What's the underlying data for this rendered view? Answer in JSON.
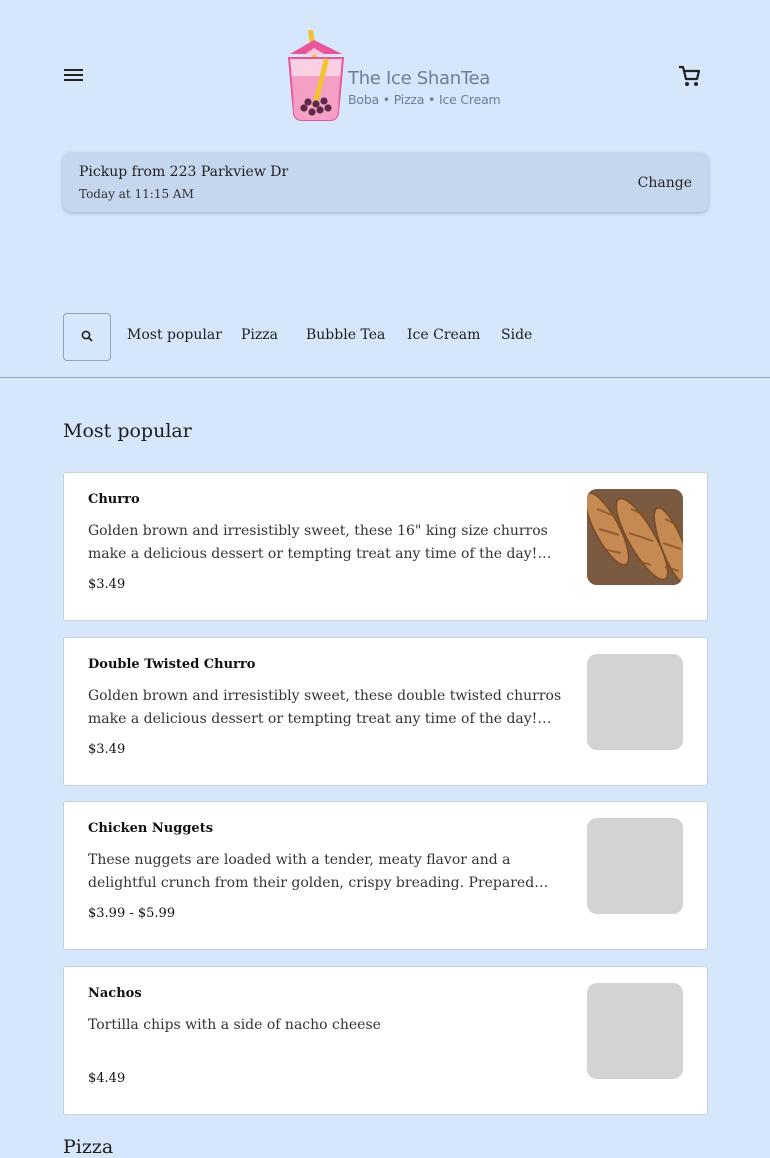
{
  "header": {
    "brand_name": "The Ice ShanTea",
    "brand_tagline": "Boba • Pizza • Ice Cream",
    "menu_icon": "hamburger-menu-icon",
    "cart_icon": "shopping-cart-icon"
  },
  "pickup": {
    "location": "Pickup from 223 Parkview Dr",
    "time": "Today at 11:15 AM",
    "change_label": "Change"
  },
  "categories": {
    "search_icon": "search-icon",
    "tabs": [
      "Most popular",
      "Pizza",
      "Bubble Tea",
      "Ice Cream",
      "Side"
    ]
  },
  "sections": [
    {
      "title": "Most popular",
      "items": [
        {
          "name": "Churro",
          "description": "Golden brown and irresistibly sweet, these 16\" king size churros make a delicious dessert or tempting treat any time of the day! Made using a traditional Hispanic recipe.",
          "price": "$3.49"
        },
        {
          "name": "Double Twisted Churro",
          "description": "Golden brown and irresistibly sweet, these double twisted churros make a delicious dessert or tempting treat any time of the day! Made using a traditional Hispanic recipe.",
          "price": "$3.49"
        },
        {
          "name": "Chicken Nuggets",
          "description": "These nuggets are loaded with a tender, meaty flavor and a delightful crunch from their golden, crispy breading. Prepared exclusively with white meat chicken.",
          "price": "$3.99 - $5.99"
        },
        {
          "name": "Nachos",
          "description": "Tortilla chips with a side of nacho cheese",
          "price": "$4.49"
        }
      ]
    },
    {
      "title": "Pizza"
    }
  ],
  "colors": {
    "page_background": "#d6e6fb",
    "pickup_background": "#c5d7ee",
    "card_background": "#ffffff",
    "image_placeholder": "#d3d3d3",
    "logo_pink": "#e9559b",
    "logo_text": "#6a7d99"
  }
}
